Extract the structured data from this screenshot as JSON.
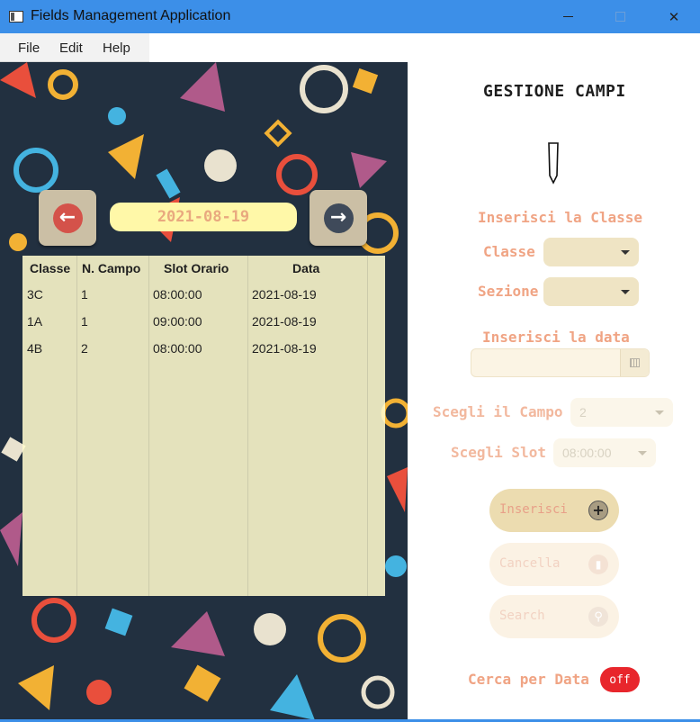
{
  "window": {
    "title": "Fields Management Application",
    "controls": {
      "minimize": "minimize-icon",
      "maximize": "maximize-icon",
      "close": "✕"
    }
  },
  "menu": {
    "items": [
      {
        "label": "File"
      },
      {
        "label": "Edit"
      },
      {
        "label": "Help"
      }
    ]
  },
  "left": {
    "prev_icon": "arrow-left-icon",
    "next_icon": "arrow-right-icon",
    "prev_glyph": "←",
    "next_glyph": "→",
    "current_date": "2021-08-19",
    "table": {
      "columns": [
        "Classe",
        "N. Campo",
        "Slot Orario",
        "Data"
      ],
      "rows": [
        [
          "3C",
          "1",
          "08:00:00",
          "2021-08-19"
        ],
        [
          "1A",
          "1",
          "09:00:00",
          "2021-08-19"
        ],
        [
          "4B",
          "2",
          "08:00:00",
          "2021-08-19"
        ]
      ]
    }
  },
  "right": {
    "heading": "GESTIONE CAMPI",
    "section_class": "Inserisci la Classe",
    "classe_label": "Classe",
    "sezione_label": "Sezione",
    "section_date": "Inserisci la data",
    "campo_label": "Scegli il Campo",
    "campo_value": "2",
    "slot_label": "Scegli Slot",
    "slot_value": "08:00:00",
    "buttons": {
      "insert": "Inserisci",
      "delete": "Cancella",
      "search": "Search"
    },
    "cerca_label": "Cerca per Data",
    "toggle_value": "off"
  },
  "colors": {
    "titlebar": "#3c8fe8",
    "accent_label": "#f0a484",
    "toggle_off": "#e8262c",
    "prev_button": "#d4524a",
    "next_button": "#3f4a5a"
  }
}
